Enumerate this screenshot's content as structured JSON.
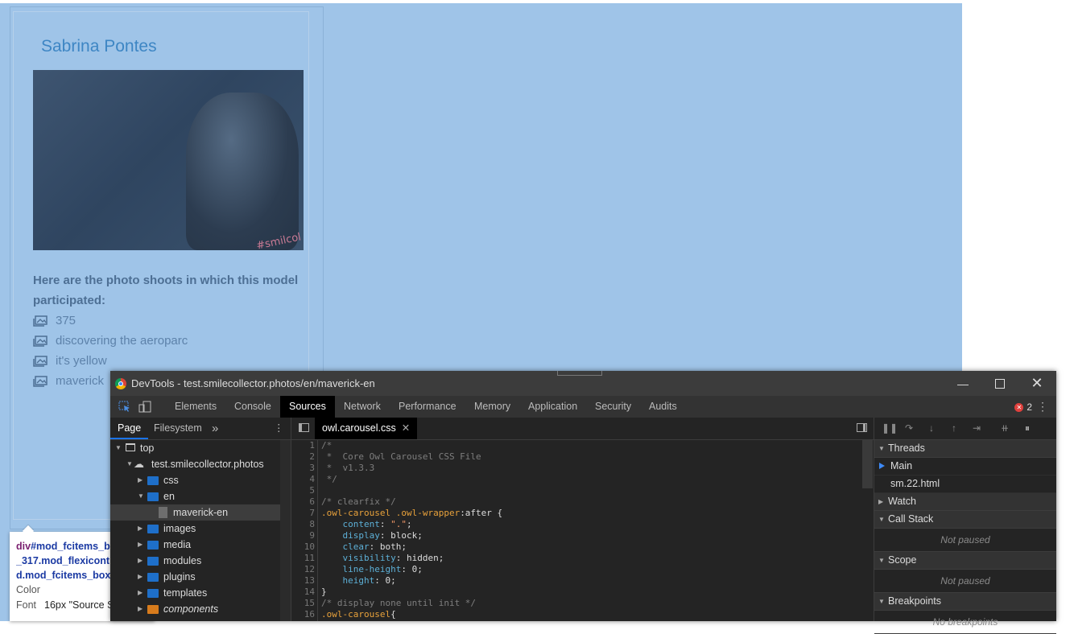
{
  "page": {
    "model_name": "Sabrina Pontes",
    "watermark": "#smilcol",
    "intro_text": "Here are the photo shoots in which this model participated:",
    "shoots": [
      "375",
      "discovering the aeroparc",
      "it's yellow",
      "maverick"
    ]
  },
  "inspector_tooltip": {
    "selector_tag": "div",
    "selector_line1": "#mod_fcitems_b",
    "selector_line2": "_317.mod_flexicont",
    "selector_line3": "d.mod_fcitems_box",
    "color_label": "Color",
    "font_label": "Font",
    "font_value": "16px \"Source S"
  },
  "devtools": {
    "title": "DevTools - test.smilecollector.photos/en/maverick-en",
    "tabs": [
      "Elements",
      "Console",
      "Sources",
      "Network",
      "Performance",
      "Memory",
      "Application",
      "Security",
      "Audits"
    ],
    "active_tab": "Sources",
    "error_count": "2",
    "navigator": {
      "tabs": [
        "Page",
        "Filesystem"
      ],
      "more": "»",
      "tree": [
        {
          "label": "top",
          "depth": 0,
          "type": "frame"
        },
        {
          "label": "test.smilecollector.photos",
          "depth": 1,
          "type": "cloud"
        },
        {
          "label": "css",
          "depth": 2,
          "type": "folder"
        },
        {
          "label": "en",
          "depth": 2,
          "type": "folder-open"
        },
        {
          "label": "maverick-en",
          "depth": 3,
          "type": "file"
        },
        {
          "label": "images",
          "depth": 2,
          "type": "folder"
        },
        {
          "label": "media",
          "depth": 2,
          "type": "folder"
        },
        {
          "label": "modules",
          "depth": 2,
          "type": "folder"
        },
        {
          "label": "plugins",
          "depth": 2,
          "type": "folder"
        },
        {
          "label": "templates",
          "depth": 2,
          "type": "folder"
        },
        {
          "label": "components",
          "depth": 2,
          "type": "folder-orange"
        }
      ]
    },
    "editor": {
      "file_tab": "owl.carousel.css",
      "lines": [
        [
          {
            "t": "/*",
            "c": "cm"
          }
        ],
        [
          {
            "t": " *  Core Owl Carousel CSS File",
            "c": "cm"
          }
        ],
        [
          {
            "t": " *  v1.3.3",
            "c": "cm"
          }
        ],
        [
          {
            "t": " */",
            "c": "cm"
          }
        ],
        [],
        [
          {
            "t": "/* clearfix */",
            "c": "cm"
          }
        ],
        [
          {
            "t": ".owl-carousel .owl-wrapper",
            "c": "sel-c"
          },
          {
            "t": ":after {",
            "c": "pl"
          }
        ],
        [
          {
            "t": "    ",
            "c": "pl"
          },
          {
            "t": "content",
            "c": "prop"
          },
          {
            "t": ": ",
            "c": "pl"
          },
          {
            "t": "\".\"",
            "c": "str"
          },
          {
            "t": ";",
            "c": "pl"
          }
        ],
        [
          {
            "t": "    ",
            "c": "pl"
          },
          {
            "t": "display",
            "c": "prop"
          },
          {
            "t": ": block;",
            "c": "pl"
          }
        ],
        [
          {
            "t": "    ",
            "c": "pl"
          },
          {
            "t": "clear",
            "c": "prop"
          },
          {
            "t": ": both;",
            "c": "pl"
          }
        ],
        [
          {
            "t": "    ",
            "c": "pl"
          },
          {
            "t": "visibility",
            "c": "prop"
          },
          {
            "t": ": hidden;",
            "c": "pl"
          }
        ],
        [
          {
            "t": "    ",
            "c": "pl"
          },
          {
            "t": "line-height",
            "c": "prop"
          },
          {
            "t": ": 0;",
            "c": "pl"
          }
        ],
        [
          {
            "t": "    ",
            "c": "pl"
          },
          {
            "t": "height",
            "c": "prop"
          },
          {
            "t": ": 0;",
            "c": "pl"
          }
        ],
        [
          {
            "t": "}",
            "c": "pl"
          }
        ],
        [
          {
            "t": "/* display none until init */",
            "c": "cm"
          }
        ],
        [
          {
            "t": ".owl-carousel",
            "c": "sel-c"
          },
          {
            "t": "{",
            "c": "pl"
          }
        ]
      ]
    },
    "debugger": {
      "threads_label": "Threads",
      "threads": [
        "Main",
        "sm.22.html"
      ],
      "watch_label": "Watch",
      "callstack_label": "Call Stack",
      "callstack_empty": "Not paused",
      "scope_label": "Scope",
      "scope_empty": "Not paused",
      "breakpoints_label": "Breakpoints",
      "breakpoints_empty": "No breakpoints"
    }
  },
  "colors": {
    "highlight_overlay": "#9fc4e8",
    "model_name": "#3e86c4",
    "devtools_bg": "#242424",
    "active_tab_bg": "#000000",
    "css_selector": "#e9a23b",
    "css_property": "#5db0d7",
    "css_comment": "#7e7e7e",
    "thread_arrow": "#3d8af7",
    "error_badge": "#e0403d"
  }
}
